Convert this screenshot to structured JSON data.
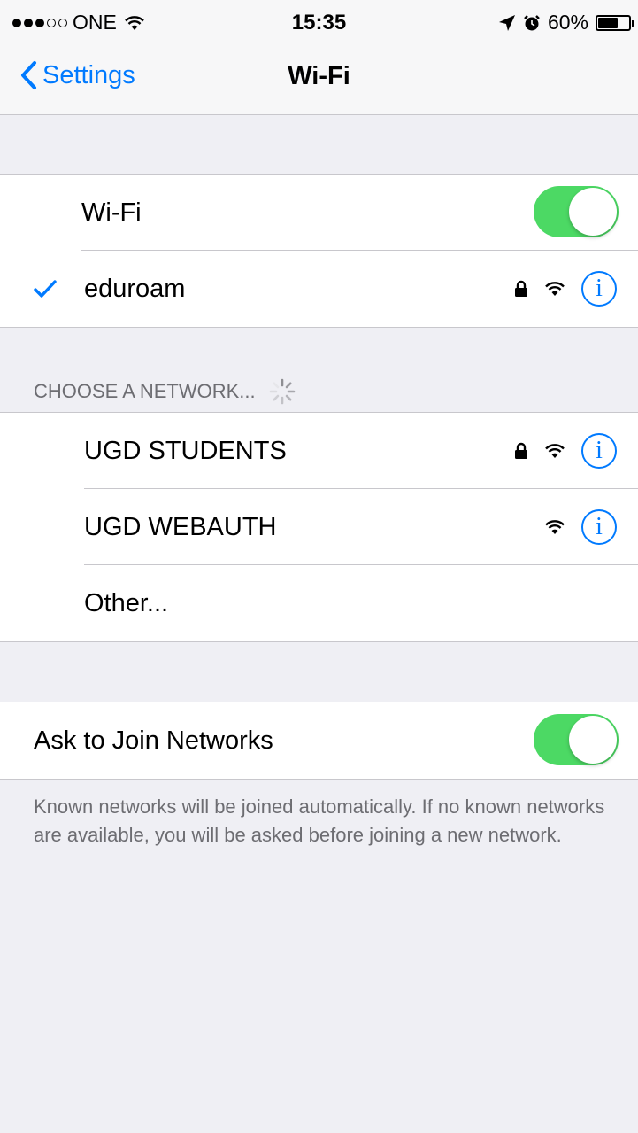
{
  "status_bar": {
    "carrier": "ONE",
    "time": "15:35",
    "battery_text": "60%",
    "battery_level": 0.6,
    "signal_dots_filled": 3,
    "signal_dots_total": 5
  },
  "nav": {
    "back_label": "Settings",
    "title": "Wi-Fi"
  },
  "wifi_section": {
    "wifi_label": "Wi-Fi",
    "wifi_enabled": true,
    "connected_network": "eduroam",
    "connected_secured": true
  },
  "networks_section": {
    "header": "CHOOSE A NETWORK...",
    "networks": [
      {
        "name": "UGD STUDENTS",
        "secured": true
      },
      {
        "name": "UGD WEBAUTH",
        "secured": false
      }
    ],
    "other_label": "Other..."
  },
  "ask_section": {
    "label": "Ask to Join Networks",
    "enabled": true,
    "footer": "Known networks will be joined automatically. If no known networks are available, you will be asked before joining a new network."
  },
  "colors": {
    "accent": "#007aff",
    "toggle_on": "#4cd964",
    "background": "#efeff4"
  },
  "icons": {
    "back": "chevron-left-icon",
    "check": "checkmark-icon",
    "lock": "lock-icon",
    "wifi": "wifi-icon",
    "info": "info-icon",
    "spinner": "spinner-icon",
    "location": "location-arrow-icon",
    "alarm": "alarm-clock-icon",
    "battery": "battery-icon"
  }
}
